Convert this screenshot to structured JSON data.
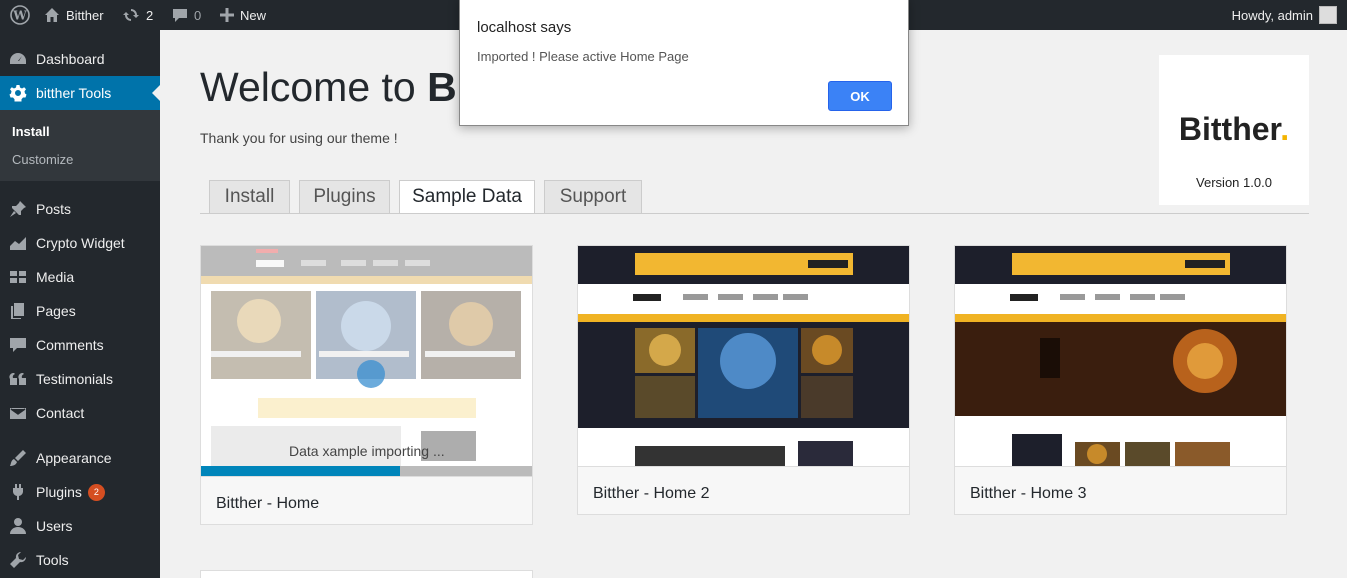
{
  "adminbar": {
    "site_name": "Bitther",
    "updates_count": "2",
    "comments_count": "0",
    "new_label": "New",
    "howdy": "Howdy, admin"
  },
  "sidebar": {
    "dashboard": "Dashboard",
    "tools_plugin": "bitther Tools",
    "sub_install": "Install",
    "sub_customize": "Customize",
    "posts": "Posts",
    "crypto_widget": "Crypto Widget",
    "media": "Media",
    "pages": "Pages",
    "comments": "Comments",
    "testimonials": "Testimonials",
    "contact": "Contact",
    "appearance": "Appearance",
    "plugins": "Plugins",
    "plugins_badge": "2",
    "users": "Users",
    "tools": "Tools"
  },
  "main": {
    "welcome_prefix": "Welcome to ",
    "welcome_bold": "B",
    "thanks": "Thank you for using our theme !",
    "brand": {
      "logo": "Bitther",
      "logo_dot": ".",
      "version": "Version 1.0.0"
    },
    "tabs": [
      "Install",
      "Plugins",
      "Sample Data",
      "Support"
    ],
    "active_tab": "Sample Data",
    "cards": [
      {
        "title": "Bitther - Home"
      },
      {
        "title": "Bitther - Home 2"
      },
      {
        "title": "Bitther - Home 3"
      }
    ],
    "import": {
      "status_text": "Data xample importing ...",
      "progress": 0.6
    }
  },
  "dialog": {
    "title": "localhost says",
    "message": "Imported ! Please active Home Page",
    "ok_label": "OK"
  },
  "colors": {
    "admin_dark": "#23282d",
    "active_blue": "#0073aa",
    "progress_blue": "#0085ba",
    "brand_accent": "#f4b400",
    "ok_button": "#3b82f6"
  }
}
